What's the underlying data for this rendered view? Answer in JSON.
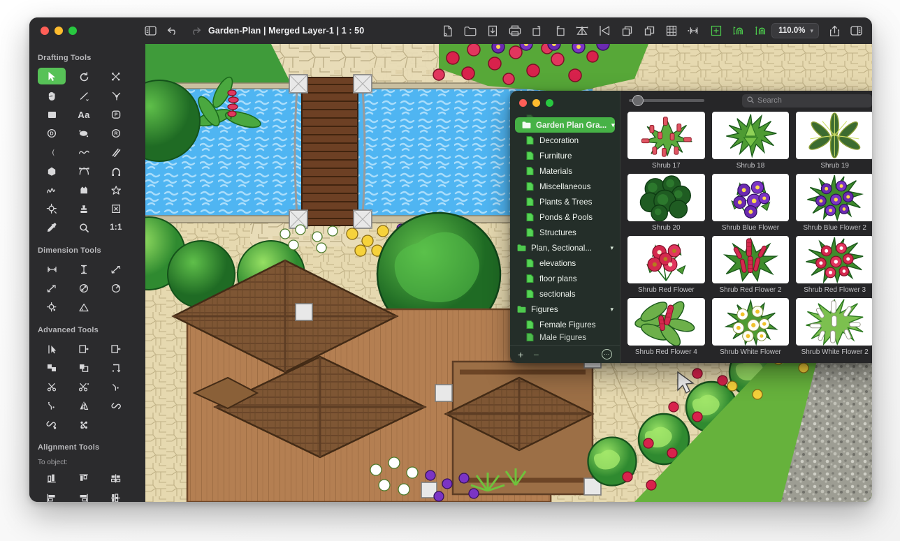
{
  "window": {
    "title": "Garden-Plan | Merged Layer-1 | 1 : 50",
    "traffic_lights": [
      "close",
      "minimize",
      "maximize"
    ]
  },
  "toolbar": {
    "left_icons": [
      {
        "name": "sidebar-toggle-icon",
        "label": "Toggle Sidebar"
      },
      {
        "name": "undo-icon",
        "label": "Undo"
      },
      {
        "name": "redo-icon",
        "label": "Redo"
      }
    ],
    "center_icons": [
      {
        "name": "new-document-icon",
        "label": "New"
      },
      {
        "name": "open-folder-icon",
        "label": "Open"
      },
      {
        "name": "import-icon",
        "label": "Import"
      },
      {
        "name": "print-icon",
        "label": "Print"
      },
      {
        "name": "rotate-right-icon",
        "label": "Rotate Right"
      },
      {
        "name": "rotate-left-icon",
        "label": "Rotate Left"
      },
      {
        "name": "mirror-icon",
        "label": "Mirror"
      },
      {
        "name": "flip-horizontal-icon",
        "label": "Flip"
      },
      {
        "name": "duplicate-icon",
        "label": "Duplicate"
      },
      {
        "name": "copy-icon",
        "label": "Copy"
      },
      {
        "name": "grid-icon",
        "label": "Grid"
      },
      {
        "name": "snap-grid-icon",
        "label": "Grid Snap"
      },
      {
        "name": "wall-measure-icon",
        "label": "Wall Measure"
      },
      {
        "name": "room-area-icon",
        "label": "Room Area"
      },
      {
        "name": "wall-tool-icon",
        "label": "Wall Tool"
      },
      {
        "name": "wall-tool-2-icon",
        "label": "Wall Tool 2"
      },
      {
        "name": "wall-tool-3-icon",
        "label": "Wall Tool 3"
      }
    ],
    "zoom": {
      "value": "110.0%",
      "chevron": "chevron-down-icon"
    },
    "right_icons": [
      {
        "name": "share-icon",
        "label": "Share"
      },
      {
        "name": "inspector-toggle-icon",
        "label": "Inspector"
      }
    ]
  },
  "sidebar": {
    "sections": [
      {
        "title": "Drafting Tools",
        "tools": [
          {
            "name": "select-arrow-icon",
            "label": "Select",
            "selected": true
          },
          {
            "name": "rotate-icon",
            "label": "Rotate",
            "selected": false
          },
          {
            "name": "crop-icon",
            "label": "Crop",
            "selected": false
          },
          {
            "name": "hand-pan-icon",
            "label": "Pan",
            "selected": false
          },
          {
            "name": "line-icon",
            "label": "Line",
            "selected": false
          },
          {
            "name": "angle-line-icon",
            "label": "Angle Line",
            "selected": false
          },
          {
            "name": "rectangle-icon",
            "label": "Rectangle",
            "selected": false
          },
          {
            "name": "text-icon",
            "label": "Text",
            "selected": false
          },
          {
            "name": "polyline-point-icon",
            "label": "Point",
            "selected": false
          },
          {
            "name": "circle-diameter-icon",
            "label": "Circle",
            "selected": false
          },
          {
            "name": "ellipse-icon",
            "label": "Ellipse",
            "selected": false
          },
          {
            "name": "radius-circle-icon",
            "label": "Radius",
            "selected": false
          },
          {
            "name": "arc-segment-icon",
            "label": "Arc Segment",
            "selected": false
          },
          {
            "name": "spline-icon",
            "label": "Spline",
            "selected": false
          },
          {
            "name": "parallel-lines-icon",
            "label": "Parallel Lines",
            "selected": false
          },
          {
            "name": "polygon-icon",
            "label": "Polygon",
            "selected": false
          },
          {
            "name": "bezier-icon",
            "label": "Bezier",
            "selected": false
          },
          {
            "name": "arch-icon",
            "label": "Arch",
            "selected": false
          },
          {
            "name": "freehand-icon",
            "label": "Freehand",
            "selected": false
          },
          {
            "name": "shape-fill-icon",
            "label": "Shape",
            "selected": false
          },
          {
            "name": "star-icon",
            "label": "Star",
            "selected": false
          },
          {
            "name": "anchor-point-icon",
            "label": "Anchor",
            "selected": false
          },
          {
            "name": "stamp-icon",
            "label": "Stamp",
            "selected": false
          },
          {
            "name": "delete-box-icon",
            "label": "Delete",
            "selected": false
          },
          {
            "name": "eyedropper-icon",
            "label": "Eyedropper",
            "selected": false
          },
          {
            "name": "magnifier-icon",
            "label": "Zoom",
            "selected": false
          },
          {
            "name": "scale-1-1-icon",
            "label": "1:1",
            "selected": false
          }
        ]
      },
      {
        "title": "Dimension Tools",
        "tools": [
          {
            "name": "horizontal-dimension-icon",
            "label": "Horizontal Dimension"
          },
          {
            "name": "vertical-dimension-icon",
            "label": "Vertical Dimension"
          },
          {
            "name": "diagonal-dimension-icon",
            "label": "Diagonal Dimension"
          },
          {
            "name": "angled-dimension-icon",
            "label": "Angled Dimension"
          },
          {
            "name": "diameter-dimension-icon",
            "label": "Diameter Dimension"
          },
          {
            "name": "radius-dimension-icon",
            "label": "Radius Dimension"
          },
          {
            "name": "center-mark-icon",
            "label": "Center Mark"
          },
          {
            "name": "angle-measure-icon",
            "label": "Angle Measure"
          }
        ]
      },
      {
        "title": "Advanced Tools",
        "tools": [
          {
            "name": "direct-select-icon",
            "label": "Direct Select"
          },
          {
            "name": "extend-right-icon",
            "label": "Extend Right"
          },
          {
            "name": "extend-left-icon",
            "label": "Extend Left"
          },
          {
            "name": "union-icon",
            "label": "Union"
          },
          {
            "name": "subtract-icon",
            "label": "Subtract"
          },
          {
            "name": "offset-icon",
            "label": "Offset"
          },
          {
            "name": "trim-icon",
            "label": "Trim"
          },
          {
            "name": "split-icon",
            "label": "Split"
          },
          {
            "name": "fillet-icon",
            "label": "Fillet"
          },
          {
            "name": "chamfer-icon",
            "label": "Chamfer"
          },
          {
            "name": "mirror-axis-icon",
            "label": "Mirror Axis"
          },
          {
            "name": "link-icon",
            "label": "Link"
          },
          {
            "name": "unlink-icon",
            "label": "Unlink"
          },
          {
            "name": "group-link-icon",
            "label": "Group Link"
          }
        ]
      },
      {
        "title": "Alignment Tools",
        "sub_label": "To object:",
        "tools": [
          {
            "name": "align-bottom-icon",
            "label": "Align Bottom"
          },
          {
            "name": "align-top-icon",
            "label": "Align Top"
          },
          {
            "name": "align-center-horizontal-icon",
            "label": "Align Center Horizontal"
          },
          {
            "name": "align-left-icon",
            "label": "Align Left"
          },
          {
            "name": "align-right-icon",
            "label": "Align Right"
          },
          {
            "name": "align-center-vertical-icon",
            "label": "Align Center Vertical"
          }
        ]
      }
    ]
  },
  "library_panel": {
    "traffic_lights": [
      "close",
      "minimize",
      "maximize"
    ],
    "search": {
      "placeholder": "Search",
      "value": "",
      "icon": "search-icon"
    },
    "size_slider": {
      "value": 12,
      "min": 0,
      "max": 100
    },
    "footer": {
      "add_label": "+",
      "remove_label": "−",
      "more_label": "⋯"
    },
    "tree": [
      {
        "label": "Garden Plan Gra...",
        "type": "folder",
        "depth": 0,
        "selected": true,
        "chevron": "chevron-down-icon"
      },
      {
        "label": "Decoration",
        "type": "file",
        "depth": 1,
        "selected": false
      },
      {
        "label": "Furniture",
        "type": "file",
        "depth": 1,
        "selected": false
      },
      {
        "label": "Materials",
        "type": "file",
        "depth": 1,
        "selected": false
      },
      {
        "label": "Miscellaneous",
        "type": "file",
        "depth": 1,
        "selected": false
      },
      {
        "label": "Plants & Trees",
        "type": "file",
        "depth": 1,
        "selected": false
      },
      {
        "label": "Ponds & Pools",
        "type": "file",
        "depth": 1,
        "selected": false
      },
      {
        "label": "Structures",
        "type": "file",
        "depth": 1,
        "selected": false
      },
      {
        "label": "Plan, Sectional...",
        "type": "folder",
        "depth": 0,
        "selected": false,
        "chevron": "chevron-down-icon"
      },
      {
        "label": "elevations",
        "type": "file",
        "depth": 1,
        "selected": false
      },
      {
        "label": "floor plans",
        "type": "file",
        "depth": 1,
        "selected": false
      },
      {
        "label": "sectionals",
        "type": "file",
        "depth": 1,
        "selected": false
      },
      {
        "label": "Figures",
        "type": "folder",
        "depth": 0,
        "selected": false,
        "chevron": "chevron-down-icon"
      },
      {
        "label": "Female Figures",
        "type": "file",
        "depth": 1,
        "selected": false
      }
    ],
    "tree_cut_off_item": {
      "label": "Male Figures",
      "type": "file",
      "depth": 1
    },
    "items": [
      {
        "label": "Shrub 17",
        "art": "shrub-red-speckled"
      },
      {
        "label": "Shrub 18",
        "art": "shrub-spiky-green"
      },
      {
        "label": "Shrub 19",
        "art": "shrub-variegated-palm"
      },
      {
        "label": "Shrub 20",
        "art": "shrub-dark-bushy"
      },
      {
        "label": "Shrub Blue Flower",
        "art": "shrub-purple-blooms"
      },
      {
        "label": "Shrub Blue Flower 2",
        "art": "shrub-purple-spiky"
      },
      {
        "label": "Shrub Red Flower",
        "art": "shrub-red-blooms"
      },
      {
        "label": "Shrub Red Flower 2",
        "art": "shrub-red-spires"
      },
      {
        "label": "Shrub Red Flower 3",
        "art": "shrub-red-spiky"
      },
      {
        "label": "Shrub Red Flower 4",
        "art": "shrub-red-broadleaf"
      },
      {
        "label": "Shrub White Flower",
        "art": "shrub-white-daisies"
      },
      {
        "label": "Shrub White Flower 2",
        "art": "shrub-white-spiky"
      }
    ]
  },
  "colors": {
    "accent_green": "#46b246",
    "window_chrome": "#2b2b2d",
    "panel_bg": "#262628",
    "water_blue": "#4eb3f0",
    "stone_beige": "#e6d9b4",
    "deck_brown": "#b07d52",
    "foliage_green": "#3d9b3d"
  }
}
